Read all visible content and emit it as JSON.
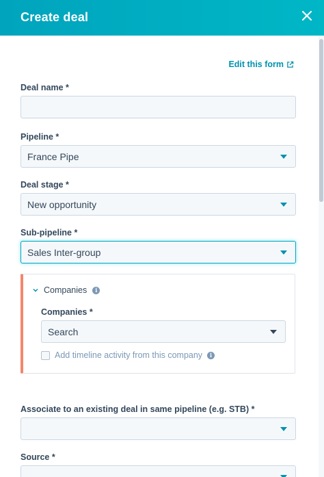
{
  "header": {
    "title": "Create deal"
  },
  "edit_form_link": "Edit this form",
  "fields": {
    "deal_name": {
      "label": "Deal name *",
      "value": ""
    },
    "pipeline": {
      "label": "Pipeline *",
      "value": "France Pipe"
    },
    "deal_stage": {
      "label": "Deal stage *",
      "value": "New opportunity"
    },
    "sub_pipeline": {
      "label": "Sub-pipeline *",
      "value": "Sales Inter-group"
    },
    "associate_deal": {
      "label": "Associate to an existing deal in same pipeline (e.g. STB) *",
      "value": ""
    },
    "source": {
      "label": "Source *",
      "value": ""
    }
  },
  "companies_card": {
    "toggle_label": "Companies",
    "field_label": "Companies *",
    "search_value": "Search",
    "checkbox_label": "Add timeline activity from this company",
    "accent_color": "#f2866c"
  },
  "icons": {
    "close": "close-icon",
    "external_link": "external-link-icon",
    "dropdown": "caret-down-icon",
    "info": "info-icon",
    "chevron": "chevron-down-icon"
  },
  "colors": {
    "header": "#00a4bd",
    "link": "#0091ae",
    "text": "#33475b"
  }
}
